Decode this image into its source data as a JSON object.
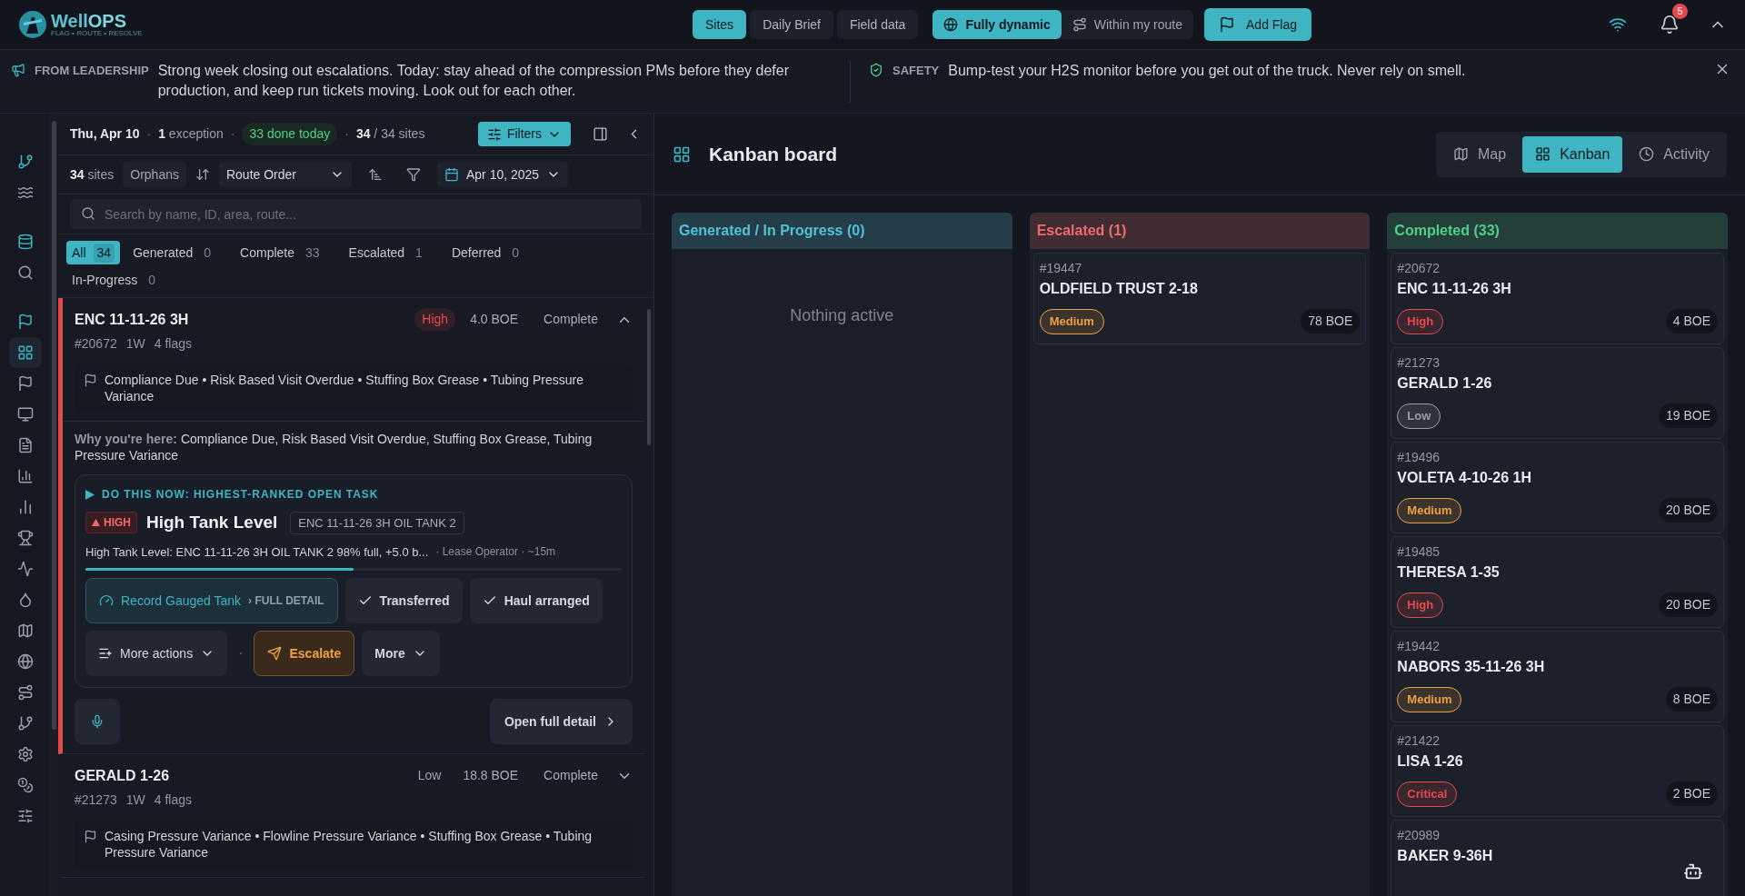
{
  "brand": {
    "name": "Well",
    "accent": "OPS",
    "tagline": "FLAG • ROUTE • RESOLVE"
  },
  "nav": [
    {
      "label": "Sites",
      "selected": true
    },
    {
      "label": "Daily Brief",
      "selected": false
    },
    {
      "label": "Field data",
      "selected": false
    }
  ],
  "modes": [
    {
      "label": "Fully dynamic",
      "selected": true
    },
    {
      "label": "Within my route",
      "selected": false
    }
  ],
  "add_flag": "Add Flag",
  "notifications": {
    "count": "5"
  },
  "banner": {
    "leadership": {
      "label": "FROM LEADERSHIP",
      "text": "Strong week closing out escalations. Today: stay ahead of the compression PMs before they defer production, and keep run tickets moving. Look out for each other."
    },
    "safety": {
      "label": "SAFETY",
      "text": "Bump-test your H2S monitor before you get out of the truck. Never rely on smell."
    }
  },
  "rail": [
    {
      "kind": "section",
      "selected": false
    },
    {
      "kind": "link",
      "selected": false
    },
    {
      "kind": "section",
      "selected": false
    },
    {
      "kind": "link",
      "selected": false
    },
    {
      "kind": "section",
      "selected": false
    },
    {
      "kind": "link",
      "selected": true
    },
    {
      "kind": "link",
      "selected": false
    },
    {
      "kind": "link",
      "selected": false
    },
    {
      "kind": "link",
      "selected": false
    },
    {
      "kind": "link",
      "selected": false
    },
    {
      "kind": "link",
      "selected": false
    },
    {
      "kind": "link",
      "selected": false
    },
    {
      "kind": "link",
      "selected": false
    },
    {
      "kind": "link",
      "selected": false
    },
    {
      "kind": "link",
      "selected": false
    },
    {
      "kind": "link",
      "selected": false
    },
    {
      "kind": "link",
      "selected": false
    },
    {
      "kind": "link",
      "selected": false
    },
    {
      "kind": "link",
      "selected": false
    },
    {
      "kind": "link",
      "selected": false
    },
    {
      "kind": "link",
      "selected": false
    }
  ],
  "summary": {
    "date": "Thu, Apr 10",
    "separator": "·",
    "exception_count": "1",
    "exception_label": "exception",
    "done": "33 done today",
    "shown": "34",
    "total": "/ 34 sites",
    "filters": "Filters"
  },
  "toolbar": {
    "count": "34",
    "count_label": "sites",
    "orphans": "Orphans",
    "sort": "Route Order",
    "date": "Apr 10, 2025"
  },
  "search": {
    "placeholder": "Search by name, ID, area, route..."
  },
  "status_tabs": [
    {
      "label": "All",
      "count": "34",
      "selected": true
    },
    {
      "label": "Generated",
      "count": "0",
      "selected": false
    },
    {
      "label": "Complete",
      "count": "33",
      "selected": false
    },
    {
      "label": "Escalated",
      "count": "1",
      "selected": false
    },
    {
      "label": "Deferred",
      "count": "0",
      "selected": false
    },
    {
      "label": "In-Progress",
      "count": "0",
      "selected": false
    }
  ],
  "sites": [
    {
      "name": "ENC 11-11-26 3H",
      "priority": "High",
      "color": "#e5484d",
      "boe": "4.0 BOE",
      "status": "Complete",
      "expanded": true,
      "id": "#20672",
      "age": "1W",
      "flag_count": "4 flags",
      "flags": "Compliance Due • Risk Based Visit Overdue • Stuffing Box Grease • Tubing Pressure Variance",
      "why_label": "Why you're here:",
      "why": "Compliance Due, Risk Based Visit Overdue, Stuffing Box Grease, Tubing Pressure Variance",
      "task": {
        "heading": "DO THIS NOW: HIGHEST-RANKED OPEN TASK",
        "severity": "HIGH",
        "title": "High Tank Level",
        "asset": "ENC 11-11-26 3H OIL TANK 2",
        "detail": "High Tank Level: ENC 11-11-26 3H OIL TANK 2 98% full, +5.0 b...",
        "meta": "· Lease Operator · ~15m",
        "level": 0.5,
        "primary": "Record Gauged Tank",
        "primary_suffix": "› FULL DETAIL",
        "checks": [
          "Transferred",
          "Haul arranged"
        ],
        "more_actions": "More actions",
        "separator": "·",
        "escalate": "Escalate",
        "more": "More",
        "open_detail": "Open full detail"
      }
    },
    {
      "name": "GERALD 1-26",
      "priority": "Low",
      "color": "#9aa0aa",
      "boe": "18.8 BOE",
      "status": "Complete",
      "expanded": false,
      "id": "#21273",
      "age": "1W",
      "flag_count": "4 flags",
      "flags": "Casing Pressure Variance • Flowline Pressure Variance • Stuffing Box Grease • Tubing Pressure Variance"
    }
  ],
  "kanban": {
    "title": "Kanban board",
    "views": [
      {
        "label": "Map",
        "selected": false
      },
      {
        "label": "Kanban",
        "selected": true
      },
      {
        "label": "Activity",
        "selected": false
      }
    ],
    "columns": [
      {
        "title": "Generated / In Progress (0)",
        "color": "#4fc3d6",
        "empty": "Nothing active"
      },
      {
        "title": "Escalated (1)",
        "color": "#f06b6b",
        "cards": [
          {
            "id": "#19447",
            "name": "OLDFIELD TRUST 2-18",
            "priority": "Medium",
            "color": "#f0a040",
            "boe": "78 BOE"
          }
        ]
      },
      {
        "title": "Completed (33)",
        "color": "#4fcf8a",
        "cards": [
          {
            "id": "#20672",
            "name": "ENC 11-11-26 3H",
            "priority": "High",
            "color": "#e5484d",
            "boe": "4 BOE"
          },
          {
            "id": "#21273",
            "name": "GERALD 1-26",
            "priority": "Low",
            "color": "#9aa0aa",
            "boe": "19 BOE"
          },
          {
            "id": "#19496",
            "name": "VOLETA 4-10-26 1H",
            "priority": "Medium",
            "color": "#f0a040",
            "boe": "20 BOE"
          },
          {
            "id": "#19485",
            "name": "THERESA 1-35",
            "priority": "High",
            "color": "#e5484d",
            "boe": "20 BOE"
          },
          {
            "id": "#19442",
            "name": "NABORS 35-11-26 3H",
            "priority": "Medium",
            "color": "#f0a040",
            "boe": "8 BOE"
          },
          {
            "id": "#21422",
            "name": "LISA 1-26",
            "priority": "Critical",
            "color": "#e5484d",
            "boe": "2 BOE"
          },
          {
            "id": "#20989",
            "name": "BAKER 9-36H"
          }
        ]
      }
    ]
  }
}
